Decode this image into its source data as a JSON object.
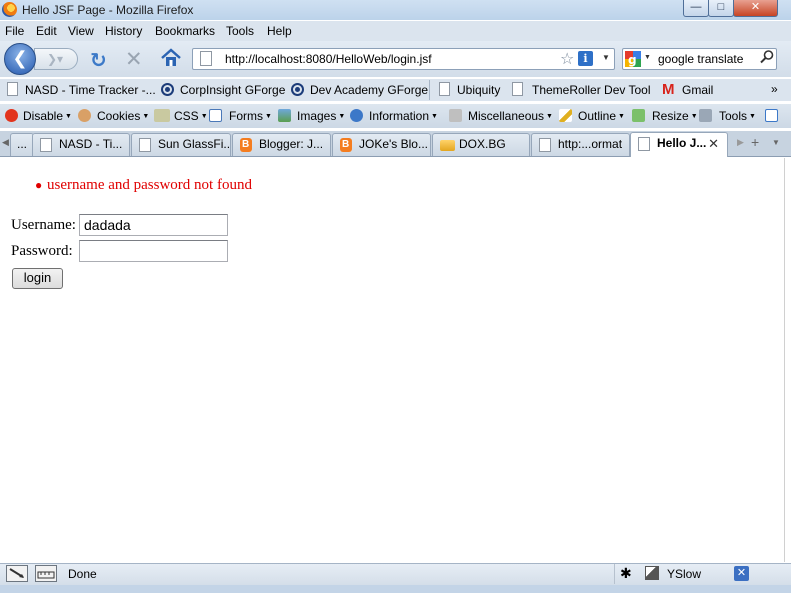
{
  "window": {
    "title": "Hello JSF Page - Mozilla Firefox",
    "min": "—",
    "max": "□",
    "close": "✕"
  },
  "menu": [
    "File",
    "Edit",
    "View",
    "History",
    "Bookmarks",
    "Tools",
    "Help"
  ],
  "nav": {
    "back": "❮",
    "forward": "❯▾",
    "reload": "↻",
    "stop": "✕",
    "url": "http://localhost:8080/HelloWeb/login.jsf",
    "star": "☆",
    "info": "i",
    "dropdown": "▼",
    "search_text": "google translate",
    "search_dropdown": "▼"
  },
  "bookmarks": {
    "items": [
      "NASD - Time Tracker -...",
      "CorpInsight GForge",
      "Dev Academy GForge",
      "Ubiquity",
      "ThemeRoller Dev Tool",
      "Gmail"
    ],
    "more": "»",
    "gmail_glyph": "M"
  },
  "devbar": [
    "Disable",
    "Cookies",
    "CSS",
    "Forms",
    "Images",
    "Information",
    "Miscellaneous",
    "Outline",
    "Resize",
    "Tools"
  ],
  "tabs": {
    "items": [
      "NASD - Ti...",
      "Sun GlassFi...",
      "Blogger: J...",
      "JOKe's Blo...",
      "DOX.BG",
      "http:...ormat",
      "Hello J..."
    ],
    "first_partial": "...",
    "close": "✕",
    "scroll_left": "◀",
    "scroll_right": "▶",
    "new": "+",
    "list": "▼"
  },
  "page": {
    "error_bullet": "●",
    "error": "username and password not found",
    "username_label": "Username:",
    "username_value": "dadada",
    "password_label": "Password:",
    "password_value": "",
    "login_button": "login"
  },
  "status": {
    "text": "Done",
    "yslow": "YSlow",
    "bug": "✱",
    "xdebug": "✕"
  },
  "colors": {
    "error": "#e00000",
    "chrome": "#dbe4ee",
    "accent": "#2458ad"
  }
}
